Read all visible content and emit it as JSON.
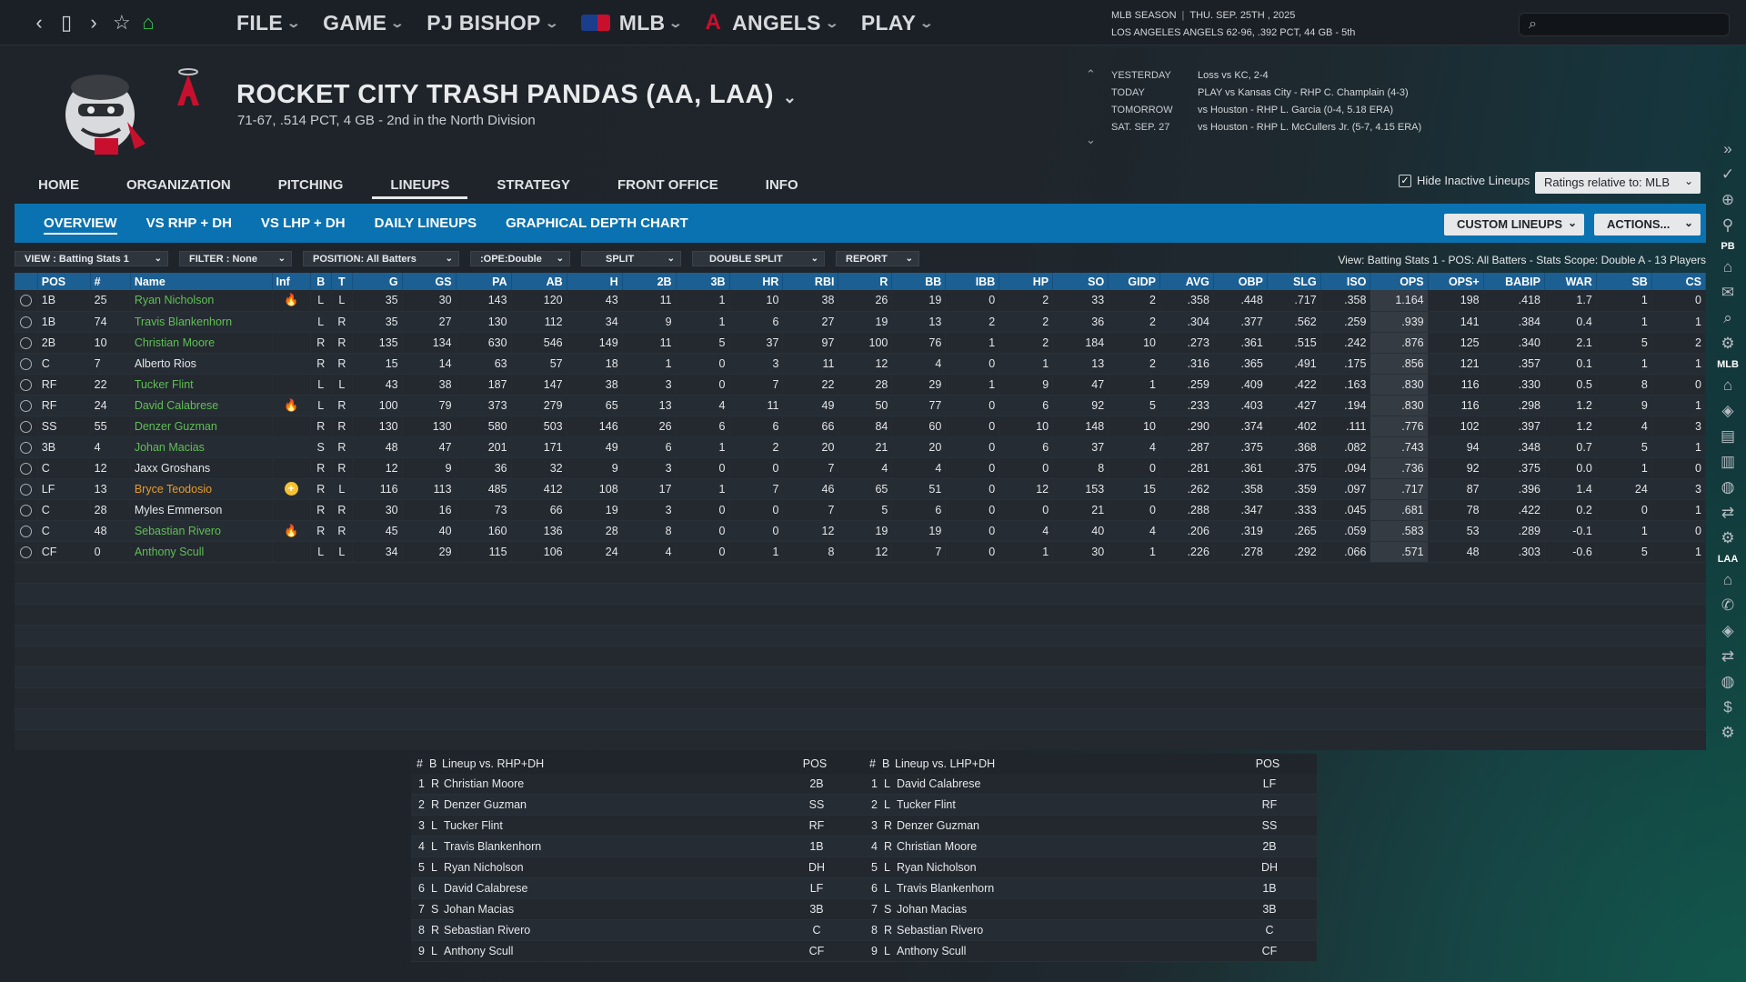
{
  "topbar": {
    "menus": [
      {
        "label": "FILE"
      },
      {
        "label": "GAME"
      },
      {
        "label": "PJ BISHOP"
      },
      {
        "label": "MLB",
        "icon": "mlb-logo-icon"
      },
      {
        "label": "ANGELS",
        "icon": "angels-logo-icon"
      },
      {
        "label": "PLAY"
      }
    ],
    "season_line1_a": "MLB SEASON",
    "season_line1_b": "THU. SEP. 25TH , 2025",
    "season_line2": "LOS ANGELES ANGELS  62-96, .392 PCT, 44 GB - 5th",
    "search_placeholder": ""
  },
  "team": {
    "title": "ROCKET CITY TRASH PANDAS (AA, LAA)",
    "subtitle": "71-67, .514 PCT, 4 GB - 2nd in the  North Division"
  },
  "schedule": [
    {
      "day": "YESTERDAY",
      "text": "Loss vs KC, 2-4"
    },
    {
      "day": "TODAY",
      "text": "PLAY vs Kansas City - RHP C. Champlain (4-3)"
    },
    {
      "day": "TOMORROW",
      "text": "vs Houston - RHP L. Garcia (0-4, 5.18 ERA)"
    },
    {
      "day": "SAT. SEP. 27",
      "text": "vs Houston - RHP L. McCullers Jr. (5-7, 4.15 ERA)"
    }
  ],
  "main_tabs": [
    "HOME",
    "ORGANIZATION",
    "PITCHING",
    "LINEUPS",
    "STRATEGY",
    "FRONT OFFICE",
    "INFO"
  ],
  "hide_inactive_label": "Hide Inactive Lineups",
  "ratings_select": "Ratings relative to: MLB",
  "sub_tabs": [
    "OVERVIEW",
    "VS RHP + DH",
    "VS LHP + DH",
    "DAILY LINEUPS",
    "GRAPHICAL DEPTH CHART"
  ],
  "custom_lineups": "CUSTOM LINEUPS",
  "actions": "ACTIONS...",
  "filters": [
    "VIEW : Batting Stats 1",
    "FILTER : None",
    "POSITION: All Batters",
    ":OPE:Double",
    "SPLIT",
    "DOUBLE SPLIT",
    "REPORT"
  ],
  "view_info": "View: Batting Stats 1 - POS: All Batters - Stats Scope: Double A - 13 Players",
  "columns": [
    "POS",
    "#",
    "Name",
    "Inf",
    "B",
    "T",
    "G",
    "GS",
    "PA",
    "AB",
    "H",
    "2B",
    "3B",
    "HR",
    "RBI",
    "R",
    "BB",
    "IBB",
    "HP",
    "SO",
    "GIDP",
    "AVG",
    "OBP",
    "SLG",
    "ISO",
    "OPS",
    "OPS+",
    "BABIP",
    "WAR",
    "SB",
    "CS"
  ],
  "players": [
    [
      "1B",
      "25",
      "Ryan Nicholson",
      "fire",
      "L",
      "L",
      "35",
      "30",
      "143",
      "120",
      "43",
      "11",
      "1",
      "10",
      "38",
      "26",
      "19",
      "0",
      "2",
      "33",
      "2",
      ".358",
      ".448",
      ".717",
      ".358",
      "1.164",
      "198",
      ".418",
      "1.7",
      "1",
      "0"
    ],
    [
      "1B",
      "74",
      "Travis Blankenhorn",
      "",
      "L",
      "R",
      "35",
      "27",
      "130",
      "112",
      "34",
      "9",
      "1",
      "6",
      "27",
      "19",
      "13",
      "2",
      "2",
      "36",
      "2",
      ".304",
      ".377",
      ".562",
      ".259",
      ".939",
      "141",
      ".384",
      "0.4",
      "1",
      "1"
    ],
    [
      "2B",
      "10",
      "Christian Moore",
      "",
      "R",
      "R",
      "135",
      "134",
      "630",
      "546",
      "149",
      "11",
      "5",
      "37",
      "97",
      "100",
      "76",
      "1",
      "2",
      "184",
      "10",
      ".273",
      ".361",
      ".515",
      ".242",
      ".876",
      "125",
      ".340",
      "2.1",
      "5",
      "2"
    ],
    [
      "C",
      "7",
      "Alberto Rios",
      "",
      "R",
      "R",
      "15",
      "14",
      "63",
      "57",
      "18",
      "1",
      "0",
      "3",
      "11",
      "12",
      "4",
      "0",
      "1",
      "13",
      "2",
      ".316",
      ".365",
      ".491",
      ".175",
      ".856",
      "121",
      ".357",
      "0.1",
      "1",
      "1"
    ],
    [
      "RF",
      "22",
      "Tucker Flint",
      "",
      "L",
      "L",
      "43",
      "38",
      "187",
      "147",
      "38",
      "3",
      "0",
      "7",
      "22",
      "28",
      "29",
      "1",
      "9",
      "47",
      "1",
      ".259",
      ".409",
      ".422",
      ".163",
      ".830",
      "116",
      ".330",
      "0.5",
      "8",
      "0"
    ],
    [
      "RF",
      "24",
      "David Calabrese",
      "fire",
      "L",
      "R",
      "100",
      "79",
      "373",
      "279",
      "65",
      "13",
      "4",
      "11",
      "49",
      "50",
      "77",
      "0",
      "6",
      "92",
      "5",
      ".233",
      ".403",
      ".427",
      ".194",
      ".830",
      "116",
      ".298",
      "1.2",
      "9",
      "1"
    ],
    [
      "SS",
      "55",
      "Denzer Guzman",
      "",
      "R",
      "R",
      "130",
      "130",
      "580",
      "503",
      "146",
      "26",
      "6",
      "6",
      "66",
      "84",
      "60",
      "0",
      "10",
      "148",
      "10",
      ".290",
      ".374",
      ".402",
      ".111",
      ".776",
      "102",
      ".397",
      "1.2",
      "4",
      "3"
    ],
    [
      "3B",
      "4",
      "Johan Macias",
      "",
      "S",
      "R",
      "48",
      "47",
      "201",
      "171",
      "49",
      "6",
      "1",
      "2",
      "20",
      "21",
      "20",
      "0",
      "6",
      "37",
      "4",
      ".287",
      ".375",
      ".368",
      ".082",
      ".743",
      "94",
      ".348",
      "0.7",
      "5",
      "1"
    ],
    [
      "C",
      "12",
      "Jaxx Groshans",
      "",
      "R",
      "R",
      "12",
      "9",
      "36",
      "32",
      "9",
      "3",
      "0",
      "0",
      "7",
      "4",
      "4",
      "0",
      "0",
      "8",
      "0",
      ".281",
      ".361",
      ".375",
      ".094",
      ".736",
      "92",
      ".375",
      "0.0",
      "1",
      "0"
    ],
    [
      "LF",
      "13",
      "Bryce Teodosio",
      "plus",
      "R",
      "L",
      "116",
      "113",
      "485",
      "412",
      "108",
      "17",
      "1",
      "7",
      "46",
      "65",
      "51",
      "0",
      "12",
      "153",
      "15",
      ".262",
      ".358",
      ".359",
      ".097",
      ".717",
      "87",
      ".396",
      "1.4",
      "24",
      "3"
    ],
    [
      "C",
      "28",
      "Myles Emmerson",
      "",
      "R",
      "R",
      "30",
      "16",
      "73",
      "66",
      "19",
      "3",
      "0",
      "0",
      "7",
      "5",
      "6",
      "0",
      "0",
      "21",
      "0",
      ".288",
      ".347",
      ".333",
      ".045",
      ".681",
      "78",
      ".422",
      "0.2",
      "0",
      "1"
    ],
    [
      "C",
      "48",
      "Sebastian Rivero",
      "fire",
      "R",
      "R",
      "45",
      "40",
      "160",
      "136",
      "28",
      "8",
      "0",
      "0",
      "12",
      "19",
      "19",
      "0",
      "4",
      "40",
      "4",
      ".206",
      ".319",
      ".265",
      ".059",
      ".583",
      "53",
      ".289",
      "-0.1",
      "1",
      "0"
    ],
    [
      "CF",
      "0",
      "Anthony Scull",
      "",
      "L",
      "L",
      "34",
      "29",
      "115",
      "106",
      "24",
      "4",
      "0",
      "1",
      "8",
      "12",
      "7",
      "0",
      "1",
      "30",
      "1",
      ".226",
      ".278",
      ".292",
      ".066",
      ".571",
      "48",
      ".303",
      "-0.6",
      "5",
      "1"
    ]
  ],
  "name_colors": [
    "g",
    "g",
    "g",
    "w",
    "g",
    "g",
    "g",
    "g",
    "w",
    "o",
    "w",
    "g",
    "g"
  ],
  "lineup_rhp": {
    "header": {
      "num": "#",
      "b": "B",
      "name": "Lineup vs. RHP+DH",
      "pos": "POS"
    },
    "rows": [
      [
        "1",
        "R",
        "Christian Moore",
        "2B"
      ],
      [
        "2",
        "R",
        "Denzer Guzman",
        "SS"
      ],
      [
        "3",
        "L",
        "Tucker Flint",
        "RF"
      ],
      [
        "4",
        "L",
        "Travis Blankenhorn",
        "1B"
      ],
      [
        "5",
        "L",
        "Ryan Nicholson",
        "DH"
      ],
      [
        "6",
        "L",
        "David Calabrese",
        "LF"
      ],
      [
        "7",
        "S",
        "Johan Macias",
        "3B"
      ],
      [
        "8",
        "R",
        "Sebastian Rivero",
        "C"
      ],
      [
        "9",
        "L",
        "Anthony Scull",
        "CF"
      ]
    ]
  },
  "lineup_lhp": {
    "header": {
      "num": "#",
      "b": "B",
      "name": "Lineup vs. LHP+DH",
      "pos": "POS"
    },
    "rows": [
      [
        "1",
        "L",
        "David Calabrese",
        "LF"
      ],
      [
        "2",
        "L",
        "Tucker Flint",
        "RF"
      ],
      [
        "3",
        "R",
        "Denzer Guzman",
        "SS"
      ],
      [
        "4",
        "R",
        "Christian Moore",
        "2B"
      ],
      [
        "5",
        "L",
        "Ryan Nicholson",
        "DH"
      ],
      [
        "6",
        "L",
        "Travis Blankenhorn",
        "1B"
      ],
      [
        "7",
        "S",
        "Johan Macias",
        "3B"
      ],
      [
        "8",
        "R",
        "Sebastian Rivero",
        "C"
      ],
      [
        "9",
        "L",
        "Anthony Scull",
        "CF"
      ]
    ]
  },
  "side_labels": {
    "pb": "PB",
    "mlb": "MLB",
    "laa": "LAA"
  }
}
